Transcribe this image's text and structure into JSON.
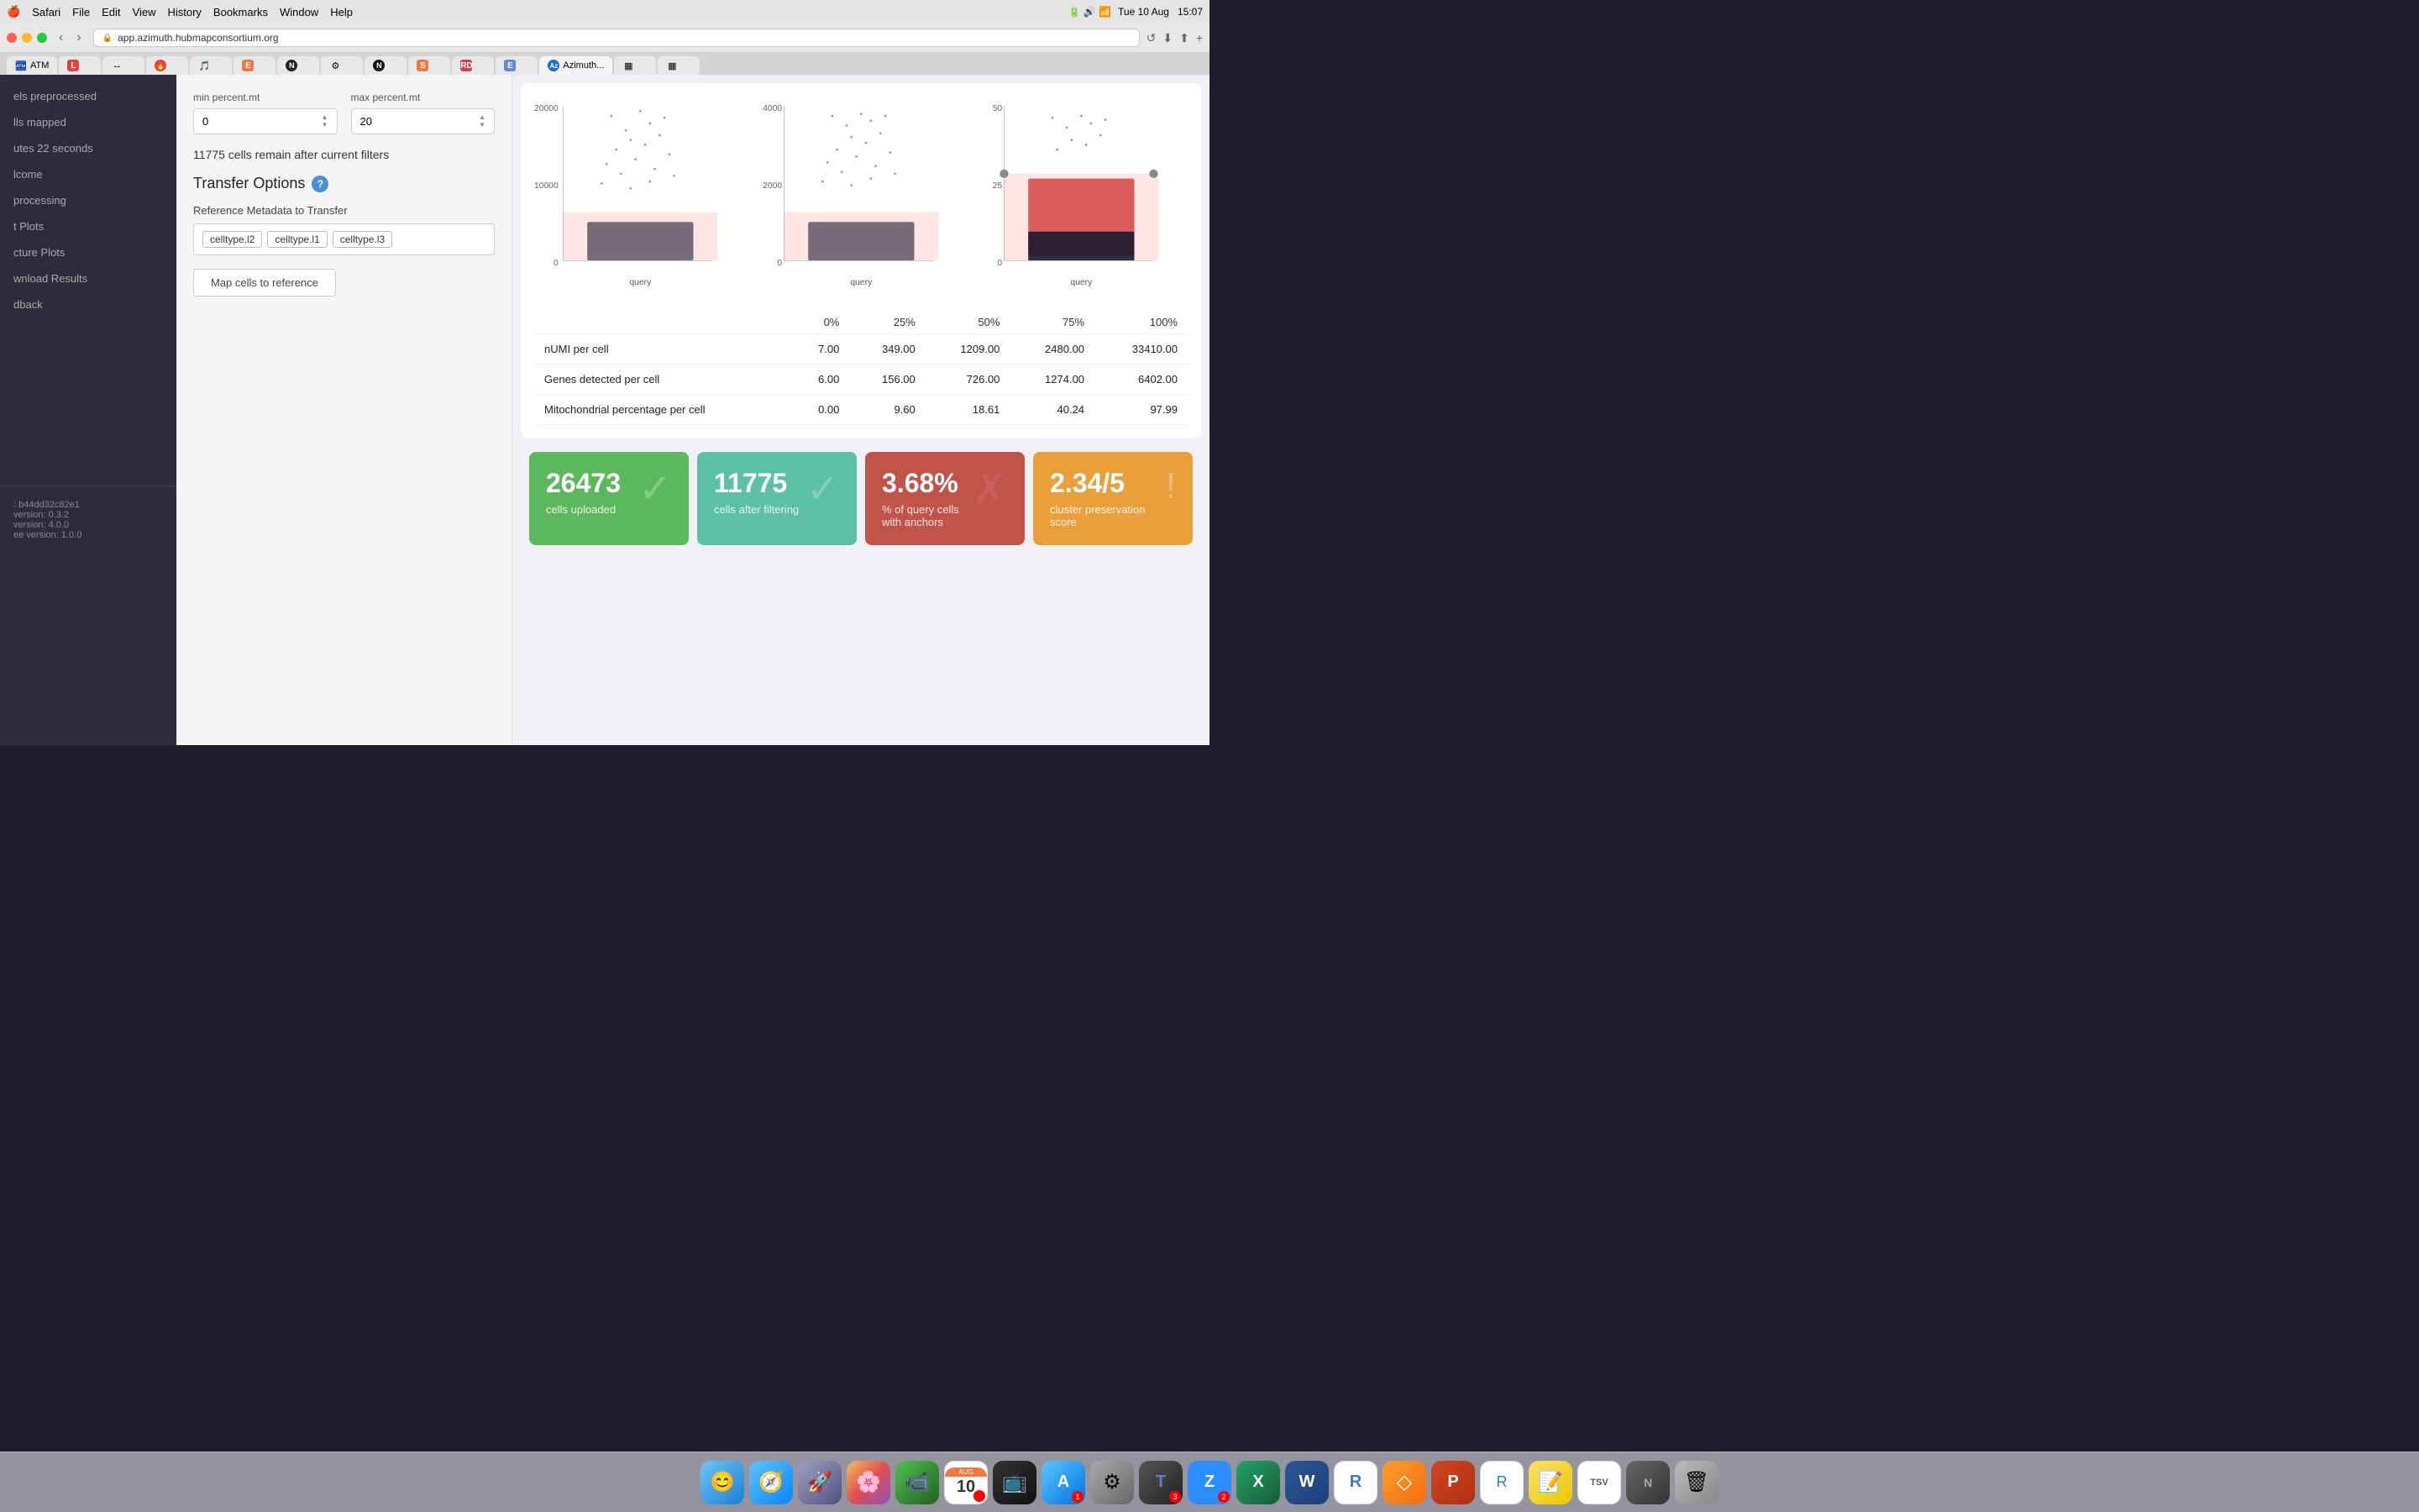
{
  "menubar": {
    "apple": "🍎",
    "items": [
      "Safari",
      "File",
      "Edit",
      "View",
      "History",
      "Bookmarks",
      "Window",
      "Help"
    ],
    "right_items": [
      "15:07",
      "Tue 10 Aug"
    ],
    "battery": "100%"
  },
  "browser": {
    "url": "app.azimuth.hubmapconsortium.org",
    "tabs": [
      {
        "label": "ATM",
        "favicon": "🏧"
      },
      {
        "label": "L",
        "favicon": "L"
      },
      {
        "label": "🔥",
        "favicon": "🔥"
      },
      {
        "label": "🎵",
        "favicon": "🎵"
      },
      {
        "label": "E",
        "favicon": "E"
      },
      {
        "label": "N",
        "favicon": "N"
      },
      {
        "label": "⚙",
        "favicon": "⚙"
      },
      {
        "label": "N",
        "favicon": "N"
      },
      {
        "label": "S",
        "favicon": "S"
      },
      {
        "label": "RD",
        "favicon": "RD"
      },
      {
        "label": "E",
        "favicon": "E"
      },
      {
        "label": "Azimuth...",
        "favicon": "Az",
        "active": true
      }
    ]
  },
  "sidebar": {
    "items": [
      {
        "label": "els preprocessed",
        "active": false
      },
      {
        "label": "lls mapped",
        "active": false
      },
      {
        "label": "utes 22 seconds",
        "active": false
      },
      {
        "label": "lcome",
        "active": false
      },
      {
        "label": "processing",
        "active": false
      },
      {
        "label": "t Plots",
        "active": false
      },
      {
        "label": "cture Plots",
        "active": false
      },
      {
        "label": "wnload Results",
        "active": false
      },
      {
        "label": "dback",
        "active": false
      }
    ],
    "info": {
      "id": ": b44dd32c82e1",
      "r_version": "version: 0.3.2",
      "seurat_version": "version: 4.0.0",
      "app_version": "ee version: 1.0.0"
    }
  },
  "filters": {
    "min_percent_mt": {
      "label": "min percent.mt",
      "value": "0"
    },
    "max_percent_mt": {
      "label": "max percent.mt",
      "value": "20"
    },
    "cells_remain_text": "11775 cells remain after current filters"
  },
  "transfer_options": {
    "title": "Transfer Options",
    "help_icon": "?",
    "meta_label": "Reference Metadata to Transfer",
    "tags": [
      "celltype.l2",
      "celltype.l1",
      "celltype.l3"
    ],
    "map_button": "Map cells to reference"
  },
  "stats_table": {
    "headers": [
      "",
      "0%",
      "25%",
      "50%",
      "75%",
      "100%"
    ],
    "rows": [
      {
        "label": "nUMI per cell",
        "v0": "7.00",
        "v25": "349.00",
        "v50": "1209.00",
        "v75": "2480.00",
        "v100": "33410.00"
      },
      {
        "label": "Genes detected per cell",
        "v0": "6.00",
        "v25": "156.00",
        "v50": "726.00",
        "v75": "1274.00",
        "v100": "6402.00"
      },
      {
        "label": "Mitochondrial percentage per cell",
        "v0": "0.00",
        "v25": "9.60",
        "v50": "18.61",
        "v75": "40.24",
        "v100": "97.99"
      }
    ]
  },
  "stat_cards": [
    {
      "value": "26473",
      "label": "cells uploaded",
      "color": "green",
      "icon": "✓"
    },
    {
      "value": "11775",
      "label": "cells after filtering",
      "color": "teal",
      "icon": "✓"
    },
    {
      "value": "3.68%",
      "label": "% of query cells with anchors",
      "color": "red",
      "icon": "✗"
    },
    {
      "value": "2.34/5",
      "label": "cluster preservation score",
      "color": "orange",
      "icon": "!"
    }
  ],
  "plots": {
    "x_axis_label": "query",
    "scatter1": {
      "y_max": "20000",
      "y_mid": "10000",
      "y_min": "0"
    },
    "scatter2": {
      "y_max": "4000",
      "y_mid": "2000",
      "y_min": "0"
    },
    "scatter3": {
      "y_max": "50",
      "y_mid": "25",
      "y_min": "0"
    }
  },
  "dock": {
    "icons": [
      {
        "name": "finder",
        "label": "Finder",
        "emoji": "😊",
        "bg": "dock-finder"
      },
      {
        "name": "safari",
        "label": "Safari",
        "emoji": "🧭",
        "bg": "dock-safari"
      },
      {
        "name": "launchpad",
        "label": "Launchpad",
        "emoji": "🚀",
        "bg": "dock-launchpad"
      },
      {
        "name": "photos",
        "label": "Photos",
        "emoji": "🌸",
        "bg": "dock-photos"
      },
      {
        "name": "facetime",
        "label": "FaceTime",
        "emoji": "📹",
        "bg": "dock-facetime"
      },
      {
        "name": "calendar",
        "label": "Calendar",
        "emoji": "📅",
        "bg": "dock-calendar",
        "badge": "10"
      },
      {
        "name": "appletv",
        "label": "Apple TV",
        "emoji": "📺",
        "bg": "dock-appletv"
      },
      {
        "name": "appstore",
        "label": "App Store",
        "emoji": "🅰",
        "bg": "dock-appstore",
        "badge": "1"
      },
      {
        "name": "settings",
        "label": "System Settings",
        "emoji": "⚙",
        "bg": "dock-settings"
      },
      {
        "name": "microsoft-teams",
        "label": "Microsoft Teams",
        "emoji": "T",
        "bg": "dock-microsoft",
        "badge": "3"
      },
      {
        "name": "zoom",
        "label": "Zoom",
        "emoji": "Z",
        "bg": "dock-zoom",
        "badge": "2"
      },
      {
        "name": "excel",
        "label": "Excel",
        "emoji": "X",
        "bg": "dock-excel"
      },
      {
        "name": "word",
        "label": "Word",
        "emoji": "W",
        "bg": "dock-word"
      },
      {
        "name": "r-app",
        "label": "R",
        "emoji": "R",
        "bg": "dock-r"
      },
      {
        "name": "sketch",
        "label": "Sketch",
        "emoji": "◇",
        "bg": "dock-sketch"
      },
      {
        "name": "powerpoint",
        "label": "PowerPoint",
        "emoji": "P",
        "bg": "dock-powerpoint"
      },
      {
        "name": "rstudio",
        "label": "RStudio",
        "emoji": "R",
        "bg": "dock-r2"
      },
      {
        "name": "notes",
        "label": "Notes",
        "emoji": "📝",
        "bg": "dock-notes"
      },
      {
        "name": "tsv",
        "label": "TSV Editor",
        "emoji": "T",
        "bg": "dock-tsv"
      },
      {
        "name": "nwb",
        "label": "NWB",
        "emoji": "N",
        "bg": "dock-nwb"
      },
      {
        "name": "trash",
        "label": "Trash",
        "emoji": "🗑",
        "bg": "dock-trash"
      }
    ]
  }
}
